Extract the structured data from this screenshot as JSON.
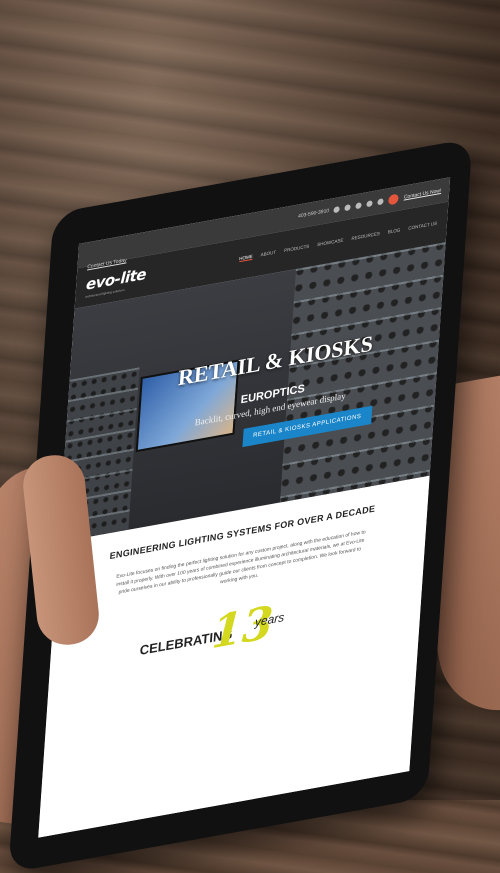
{
  "topbar": {
    "phone": "403-590-3910",
    "link": "Contact Us Now!",
    "icons": [
      "twitter-icon",
      "facebook-icon",
      "pinterest-icon",
      "linkedin-icon",
      "youtube-icon"
    ]
  },
  "navbar": {
    "contact": "Contact Us Today",
    "logo": "evo-lite",
    "logo_sub": "architectural lighting solutions",
    "items": [
      "Home",
      "About",
      "Products",
      "Showcase",
      "Resources",
      "Blog",
      "Contact Us"
    ],
    "active": "Home"
  },
  "hero": {
    "title": "RETAIL & KIOSKS",
    "subtitle": "EUROPTICS",
    "description": "Backlit, curved, high end eyewear display",
    "button": "RETAIL & KIOSKS APPLICATIONS"
  },
  "content": {
    "heading": "ENGINEERING LIGHTING SYSTEMS FOR OVER A DECADE",
    "body": "Evo-Lite focuses on finding the perfect lighting solution for any custom project, along with the education of how to install it properly. With over 100 years of combined experience illuminating architectural materials, we at Evo-Lite pride ourselves in our ability to professionally guide our clients from concept to completion. We look forward to working with you.",
    "celebrating": "CELEBRATING",
    "number": "13",
    "years": "years"
  },
  "colors": {
    "accent": "#e4563b",
    "button": "#1a86c9",
    "logo_mark": "#d4d81e"
  }
}
